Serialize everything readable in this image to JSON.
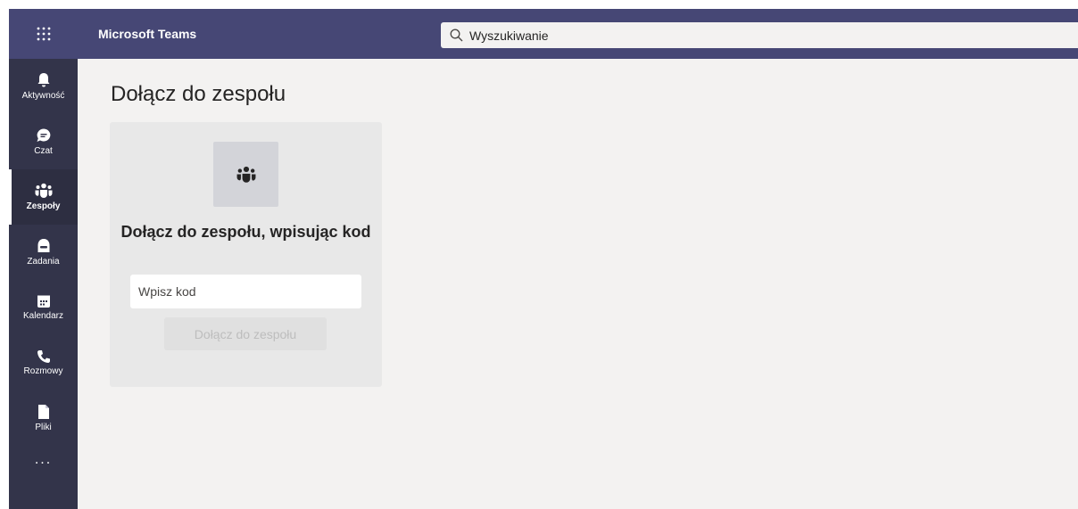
{
  "topbar": {
    "app_title": "Microsoft Teams",
    "search_placeholder": "Wyszukiwanie",
    "bg_color": "#464775"
  },
  "rail": {
    "items": [
      {
        "label": "Aktywność",
        "icon": "bell-icon"
      },
      {
        "label": "Czat",
        "icon": "chat-icon"
      },
      {
        "label": "Zespoły",
        "icon": "teams-icon",
        "active": true
      },
      {
        "label": "Zadania",
        "icon": "assignments-icon"
      },
      {
        "label": "Kalendarz",
        "icon": "calendar-icon"
      },
      {
        "label": "Rozmowy",
        "icon": "phone-icon"
      },
      {
        "label": "Pliki",
        "icon": "file-icon"
      }
    ],
    "more": "...",
    "bg_color": "#33344a"
  },
  "main": {
    "title": "Dołącz do zespołu",
    "card": {
      "heading": "Dołącz do zespołu, wpisując kod",
      "input_placeholder": "Wpisz kod",
      "input_value": "",
      "button_label": "Dołącz do zespołu",
      "button_disabled": true
    }
  }
}
